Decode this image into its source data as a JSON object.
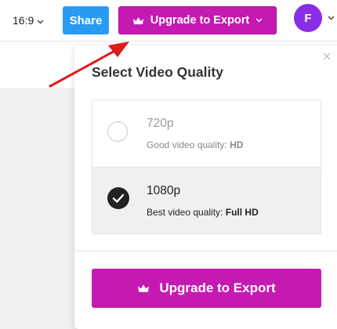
{
  "toolbar": {
    "aspect_ratio": "16:9",
    "share_label": "Share",
    "upgrade_label": "Upgrade to Export",
    "avatar_initial": "F"
  },
  "quality_panel": {
    "title": "Select Video Quality",
    "options": [
      {
        "name": "720p",
        "desc_prefix": "Good video quality: ",
        "desc_strong": "HD",
        "selected": false
      },
      {
        "name": "1080p",
        "desc_prefix": "Best video quality: ",
        "desc_strong": "Full HD",
        "selected": true
      }
    ],
    "cta_label": "Upgrade to Export"
  },
  "colors": {
    "brand_magenta": "#c41ab1",
    "share_blue": "#2a9bf2",
    "avatar_purple": "#8a2ee5",
    "annotation_red": "#e01b1b"
  },
  "icons": [
    "chevron-down-icon",
    "crown-icon",
    "close-icon",
    "check-icon",
    "arrow-annotation"
  ]
}
